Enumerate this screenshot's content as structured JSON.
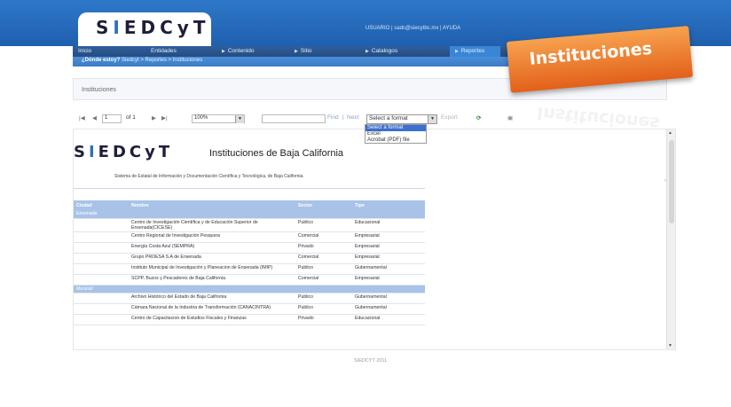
{
  "app": {
    "logo": "SIEDCyT",
    "logo_pre": "S",
    "logo_i": "I",
    "logo_post": "EDCyT"
  },
  "header": {
    "user_line": "USUARIO | sadc@siecytbc.mx | AYUDA"
  },
  "nav": {
    "items": [
      {
        "label": "Inicio"
      },
      {
        "label": "Entidades"
      },
      {
        "label": "Contenido"
      },
      {
        "label": "Sitio"
      },
      {
        "label": "Catalogos"
      },
      {
        "label": "Reportes"
      }
    ]
  },
  "breadcrumb": {
    "lead": "¿Dónde estoy?",
    "path": "Siedcyt > Reportes > Instituciones"
  },
  "page": {
    "title": "Instituciones"
  },
  "ribbon": {
    "label": "Instituciones"
  },
  "toolbar": {
    "page_value": "1",
    "page_of": "of 1",
    "zoom": "100%",
    "find_placeholder": "",
    "find": "Find",
    "next": "Next",
    "format_selected": "Select a format",
    "export": "Export"
  },
  "format_options": [
    "Select a format",
    "Excel",
    "Acrobat (PDF) file"
  ],
  "report": {
    "logo_pre": "S",
    "logo_i": "I",
    "logo_post": "EDCyT",
    "title": "Instituciones de Baja California",
    "subtitle": "Sistema de Estatal de Información y Documentación Científica y Tecnológica, de Baja California.",
    "columns": [
      "Ciudad",
      "Nombre",
      "Sector",
      "Tipo"
    ],
    "groups": [
      {
        "city": "Ensenada",
        "rows": [
          {
            "nombre": "Centro de Investigación Científica y de Educación Superior de Ensenada(CICESE)",
            "sector": "Publico",
            "tipo": "Educacional"
          },
          {
            "nombre": "Centro Regional de Investigación Pesquera",
            "sector": "Comercial",
            "tipo": "Empresarial"
          },
          {
            "nombre": "Energía Costa Azul (SEMPRA)",
            "sector": "Privado",
            "tipo": "Empresarial"
          },
          {
            "nombre": "Grupo PROESA S.A de Ensenada",
            "sector": "Comercial",
            "tipo": "Empresarial"
          },
          {
            "nombre": "Instituto Municipal de Investigación y Planeacion de Ensenada (IMIP)",
            "sector": "Publico",
            "tipo": "Gubernamental"
          },
          {
            "nombre": "SCPP, Buzos y Pescadores de Baja California",
            "sector": "Comercial",
            "tipo": "Empresarial"
          }
        ]
      },
      {
        "city": "Mexicali",
        "rows": [
          {
            "nombre": "Archivo Histórico del Estado de Baja California",
            "sector": "Publico",
            "tipo": "Gubernamental"
          },
          {
            "nombre": "Cámara Nacional de la Industria de Transformación (CANACINTRA)",
            "sector": "Publico",
            "tipo": "Gubernamental"
          },
          {
            "nombre": "Centro de Capacitacion de Estudios Fiscales y Finanzas",
            "sector": "Privado",
            "tipo": "Educacional"
          }
        ]
      }
    ]
  },
  "footer": {
    "text": "SIEDCYT 2011"
  }
}
